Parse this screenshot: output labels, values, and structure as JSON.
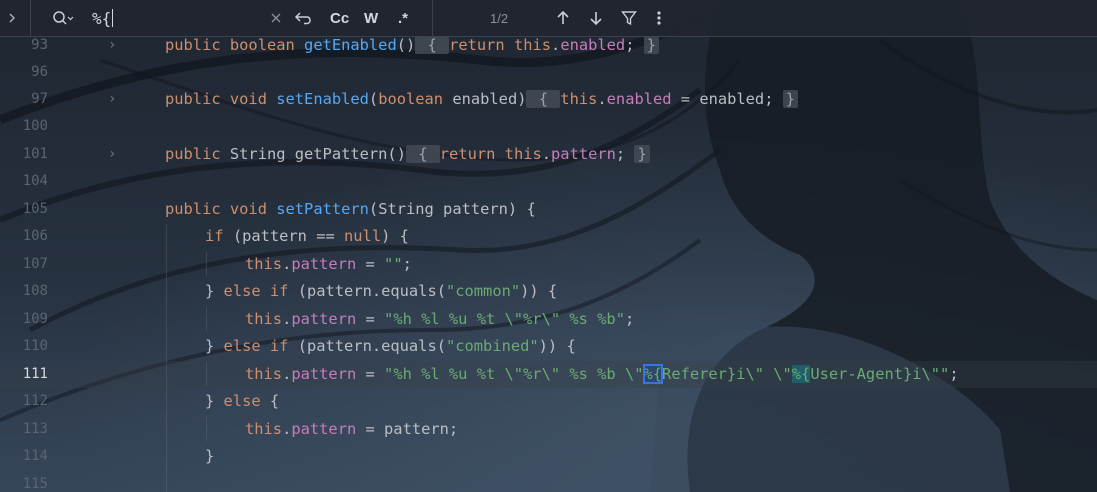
{
  "search_bar": {
    "expand_icon": "chevron-right-icon",
    "search_icon": "search-history-icon",
    "query": "%{",
    "clear_icon": "close-icon",
    "newline_icon": "new-line-icon",
    "match_case_label": "Cc",
    "words_label": "W",
    "regex_label": ".*",
    "match_count": "1/2",
    "prev_icon": "arrow-up-icon",
    "next_icon": "arrow-down-icon",
    "filter_icon": "filter-icon",
    "more_icon": "more-vertical-icon"
  },
  "editor": {
    "current_line": "111",
    "lines": [
      {
        "num": "93"
      },
      {
        "num": "96"
      },
      {
        "num": "97"
      },
      {
        "num": "100"
      },
      {
        "num": "101"
      },
      {
        "num": "104"
      },
      {
        "num": "105"
      },
      {
        "num": "106"
      },
      {
        "num": "107"
      },
      {
        "num": "108"
      },
      {
        "num": "109"
      },
      {
        "num": "110"
      },
      {
        "num": "111"
      },
      {
        "num": "112"
      },
      {
        "num": "113"
      },
      {
        "num": "114"
      },
      {
        "num": "115"
      }
    ],
    "tokens": {
      "l93": [
        "public",
        " ",
        "boolean",
        " ",
        "getEnabled",
        "()",
        " { ",
        "return",
        " ",
        "this",
        ".",
        "enabled",
        "; ",
        "}"
      ],
      "l97": [
        "public",
        " ",
        "void",
        " ",
        "setEnabled",
        "(",
        "boolean",
        " enabled)",
        " { ",
        "this",
        ".",
        "enabled",
        " = enabled; ",
        "}"
      ],
      "l101": [
        "public",
        " ",
        "String getPattern",
        "()",
        " { ",
        "return",
        " ",
        "this",
        ".",
        "pattern",
        "; ",
        "}"
      ],
      "l105": [
        "public",
        " ",
        "void",
        " ",
        "setPattern",
        "(String pattern) {"
      ],
      "l106": [
        "if",
        " (pattern == ",
        "null",
        ") {"
      ],
      "l107": [
        "this",
        ".",
        "pattern",
        " = ",
        "\"\"",
        ";"
      ],
      "l108": [
        "} ",
        "else",
        " ",
        "if",
        " (pattern.equals(",
        "\"common\"",
        ")) {"
      ],
      "l109": [
        "this",
        ".",
        "pattern",
        " = ",
        "\"%h %l %u %t \\\"%r\\\" %s %b\"",
        ";"
      ],
      "l110": [
        "} ",
        "else",
        " ",
        "if",
        " (pattern.equals(",
        "\"combined\"",
        ")) {"
      ],
      "l111": [
        "this",
        ".",
        "pattern",
        " = ",
        "\"%h %l %u %t \\\"%r\\\" %s %b \\\"",
        "%{",
        "Referer}i\\\" \\\"",
        "%{",
        "User-Agent}i\\\"\"",
        ";"
      ],
      "l112": [
        "} ",
        "else",
        " {"
      ],
      "l113": [
        "this",
        ".",
        "pattern",
        " = pattern;"
      ],
      "l114": [
        "}"
      ]
    }
  }
}
